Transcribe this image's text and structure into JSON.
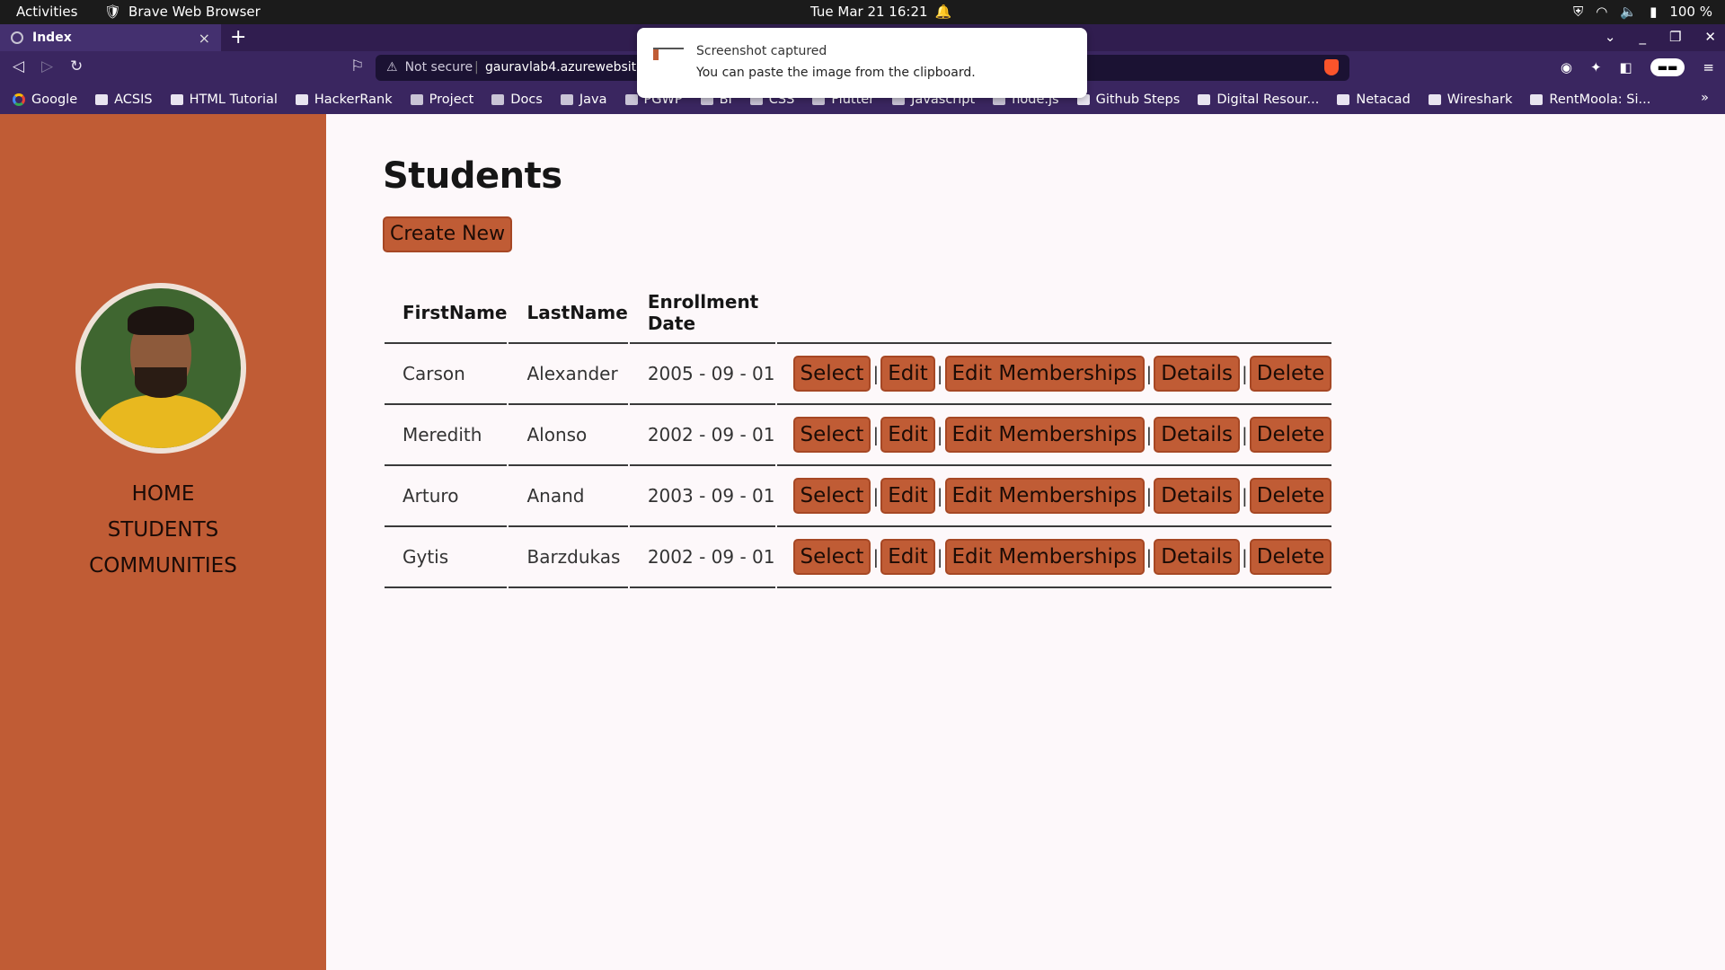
{
  "system": {
    "activities": "Activities",
    "app_name": "Brave Web Browser",
    "datetime": "Tue Mar 21  16:21",
    "battery": "100 %"
  },
  "browser": {
    "tab_title": "Index",
    "url_security": "Not secure",
    "url": "gauravlab4.azurewebsites.n",
    "bookmarks": [
      {
        "label": "Google",
        "icon": "google-icon"
      },
      {
        "label": "ACSIS",
        "icon": "acsis-icon"
      },
      {
        "label": "HTML Tutorial",
        "icon": "w3schools-icon"
      },
      {
        "label": "HackerRank",
        "icon": "hackerrank-icon"
      },
      {
        "label": "Project",
        "icon": "folder-icon"
      },
      {
        "label": "Docs",
        "icon": "folder-icon"
      },
      {
        "label": "Java",
        "icon": "folder-icon"
      },
      {
        "label": "PGWP",
        "icon": "folder-icon"
      },
      {
        "label": "BI",
        "icon": "folder-icon"
      },
      {
        "label": "CSS",
        "icon": "folder-icon"
      },
      {
        "label": "Flutter",
        "icon": "folder-icon"
      },
      {
        "label": "Javascript",
        "icon": "folder-icon"
      },
      {
        "label": "node.js",
        "icon": "folder-icon"
      },
      {
        "label": "Github Steps",
        "icon": "github-icon"
      },
      {
        "label": "Digital Resour...",
        "icon": "digital-resources-icon"
      },
      {
        "label": "Netacad",
        "icon": "netacad-icon"
      },
      {
        "label": "Wireshark",
        "icon": "wireshark-icon"
      },
      {
        "label": "RentMoola: Si...",
        "icon": "rentmoola-icon"
      }
    ],
    "bookmarks_more": "»"
  },
  "notification": {
    "title": "Screenshot captured",
    "body": "You can paste the image from the clipboard."
  },
  "sidebar": {
    "nav": [
      "HOME",
      "STUDENTS",
      "COMMUNITIES"
    ]
  },
  "main": {
    "title": "Students",
    "create_label": "Create New",
    "columns": [
      "FirstName",
      "LastName",
      "Enrollment Date"
    ],
    "action_labels": {
      "select": "Select",
      "edit": "Edit",
      "memberships": "Edit Memberships",
      "details": "Details",
      "delete": "Delete",
      "separator": "|"
    },
    "rows": [
      {
        "first": "Carson",
        "last": "Alexander",
        "date": "2005 - 09 - 01"
      },
      {
        "first": "Meredith",
        "last": "Alonso",
        "date": "2002 - 09 - 01"
      },
      {
        "first": "Arturo",
        "last": "Anand",
        "date": "2003 - 09 - 01"
      },
      {
        "first": "Gytis",
        "last": "Barzdukas",
        "date": "2002 - 09 - 01"
      }
    ]
  },
  "colors": {
    "accent": "#c05c35",
    "browser_chrome": "#3a2660",
    "page_bg": "#fdf8fa"
  }
}
